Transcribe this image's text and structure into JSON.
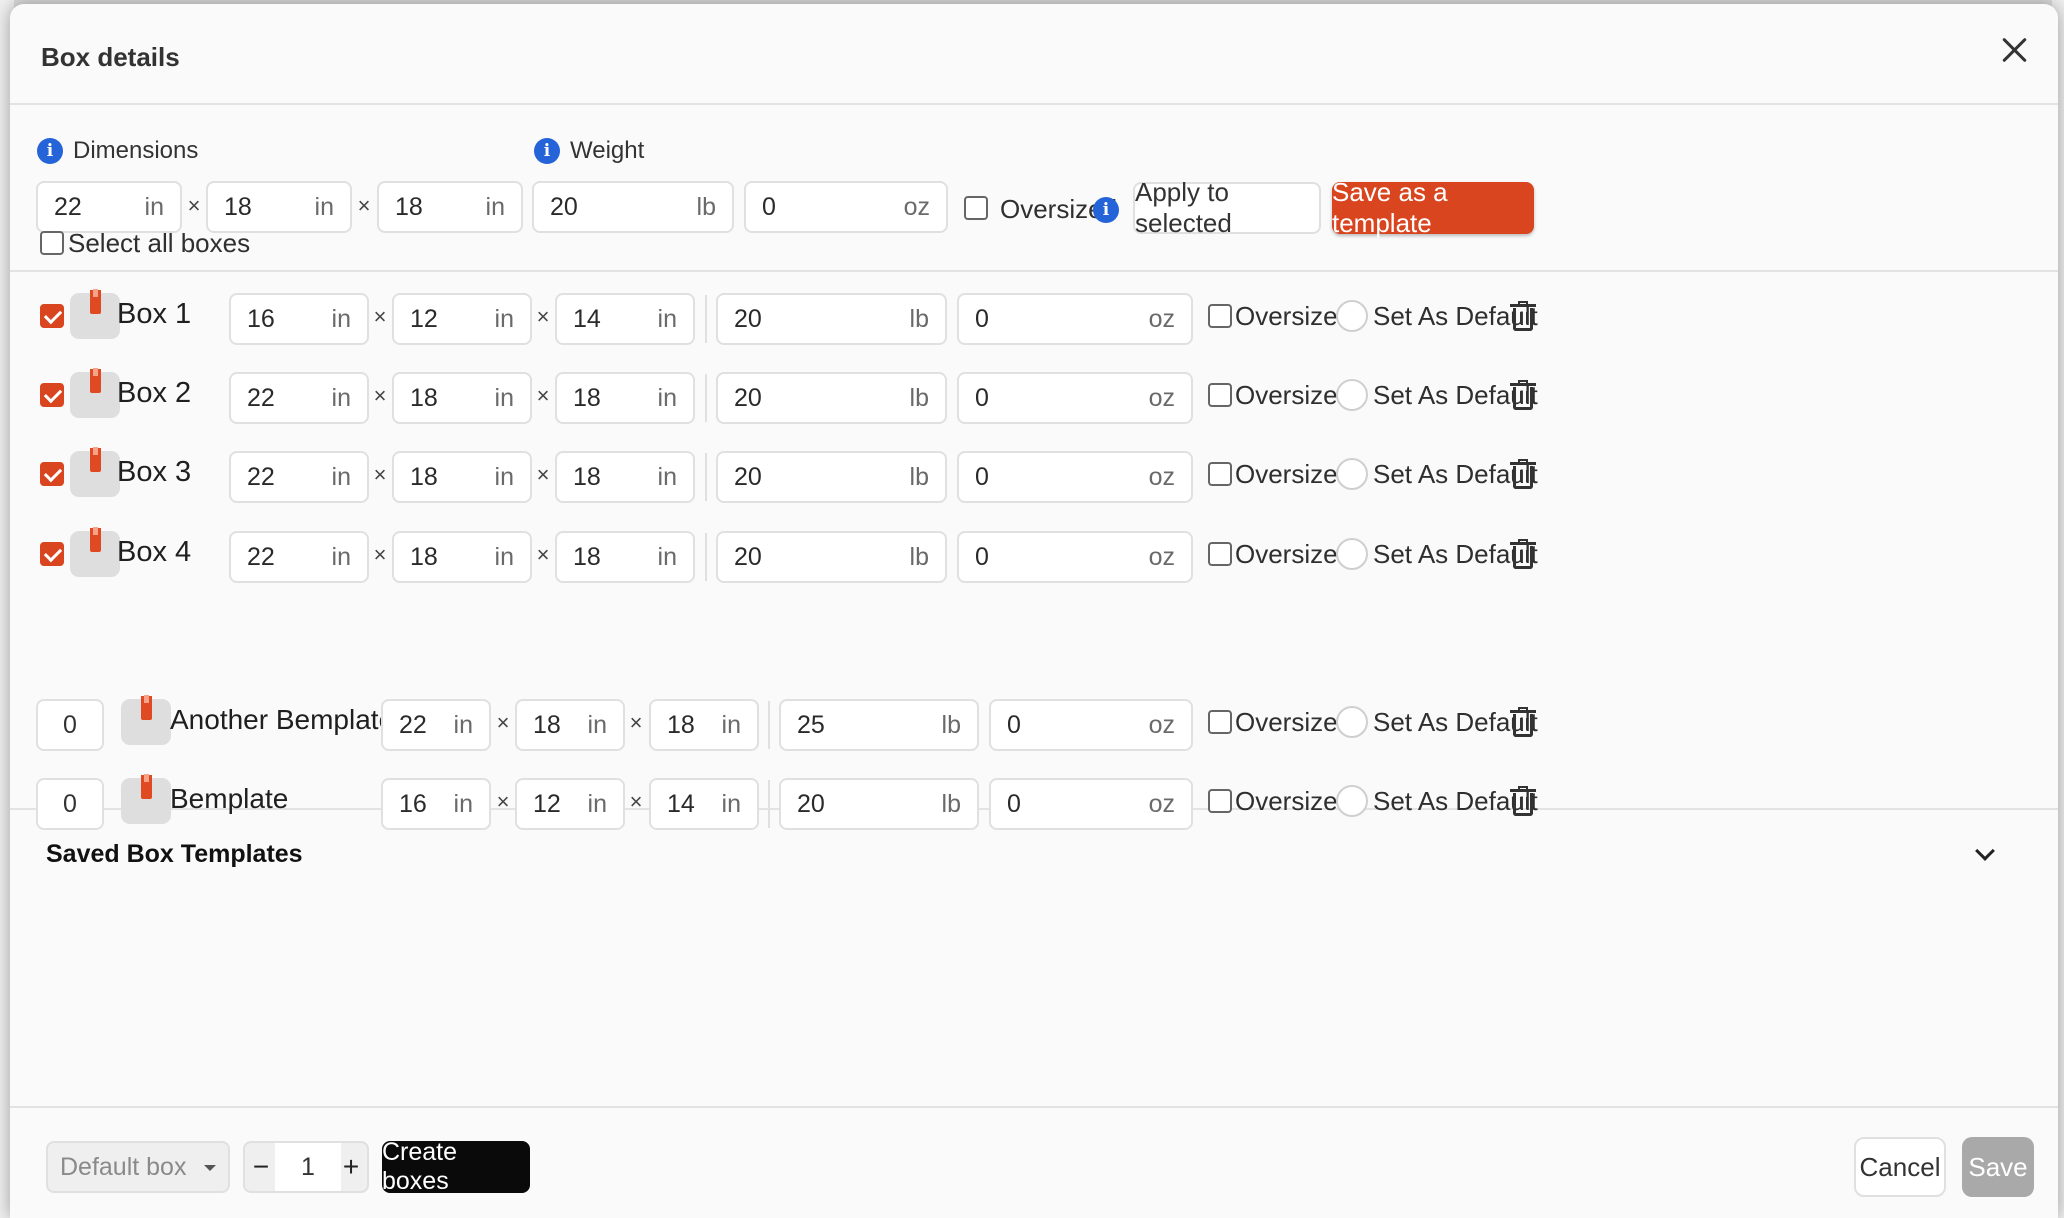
{
  "dialog": {
    "title": "Box details"
  },
  "top": {
    "dimensions_label": "Dimensions",
    "weight_label": "Weight",
    "length": "22",
    "width": "18",
    "height": "18",
    "length_unit": "in",
    "width_unit": "in",
    "height_unit": "in",
    "weight_lb": "20",
    "weight_unit_lb": "lb",
    "weight_oz": "0",
    "weight_unit_oz": "oz",
    "oversized_label": "Oversized",
    "apply_label": "Apply to selected",
    "save_template_label": "Save as a template",
    "times": "×"
  },
  "select_all_label": "Select all boxes",
  "boxes": [
    {
      "name": "Box 1",
      "checked": true,
      "l": "16",
      "w": "12",
      "h": "14",
      "lb": "20",
      "oz": "0"
    },
    {
      "name": "Box 2",
      "checked": true,
      "l": "22",
      "w": "18",
      "h": "18",
      "lb": "20",
      "oz": "0"
    },
    {
      "name": "Box 3",
      "checked": true,
      "l": "22",
      "w": "18",
      "h": "18",
      "lb": "20",
      "oz": "0"
    },
    {
      "name": "Box 4",
      "checked": true,
      "l": "22",
      "w": "18",
      "h": "18",
      "lb": "20",
      "oz": "0"
    }
  ],
  "row_labels": {
    "in": "in",
    "lb": "lb",
    "oz": "oz",
    "times": "×",
    "oversized": "Oversized",
    "set_default": "Set As Default"
  },
  "templates": {
    "title": "Saved Box Templates",
    "items": [
      {
        "qty": "0",
        "name": "Another Bemplate",
        "l": "22",
        "w": "18",
        "h": "18",
        "lb": "25",
        "oz": "0"
      },
      {
        "qty": "0",
        "name": "Bemplate",
        "l": "16",
        "w": "12",
        "h": "14",
        "lb": "20",
        "oz": "0"
      }
    ]
  },
  "footer": {
    "select_value": "Default box",
    "minus": "−",
    "count": "1",
    "plus": "+",
    "create_label": "Create boxes",
    "cancel_label": "Cancel",
    "save_label": "Save"
  },
  "colors": {
    "accent": "#d8451f",
    "info": "#2563d9",
    "dark_button": "#0a0a0a",
    "disabled": "#a9a9a9"
  }
}
